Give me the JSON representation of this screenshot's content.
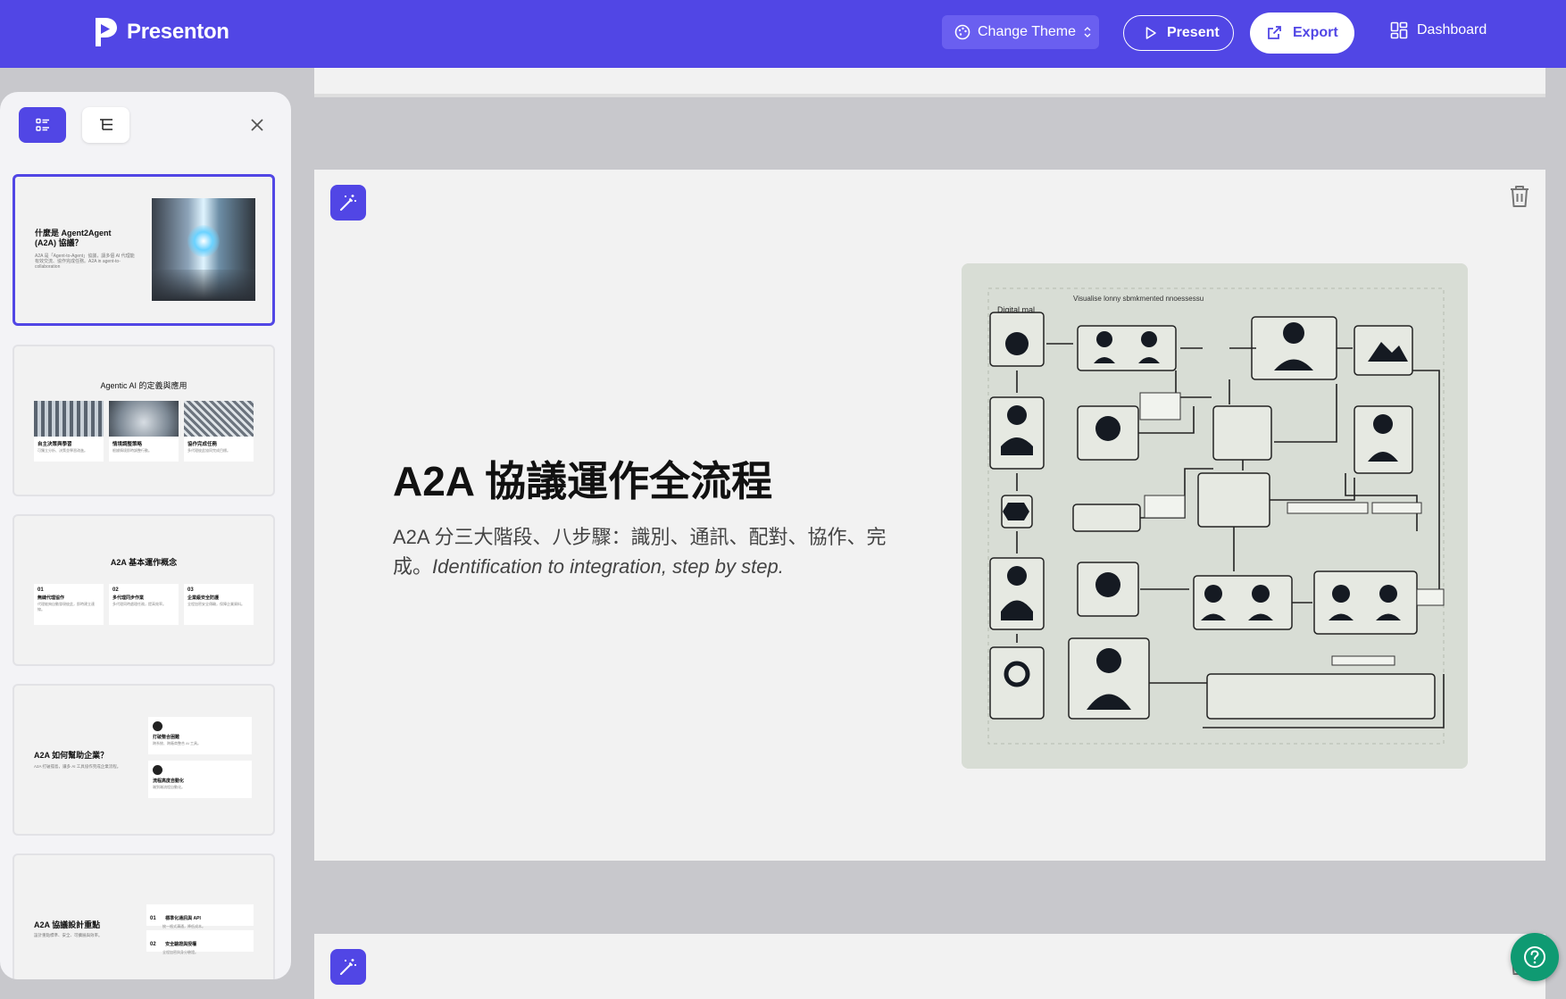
{
  "app": {
    "brand": "Presenton",
    "change_theme_label": "Change Theme",
    "present_label": "Present",
    "export_label": "Export",
    "dashboard_label": "Dashboard",
    "accent": "#5146e5"
  },
  "sidebar": {
    "thumbnails": [
      {
        "title": "什麼是 Agent2Agent (A2A) 協議？",
        "body": "A2A 是「Agent-to-Agent」協議，讓多個 AI 代理能有效交流、協作完成任務。A2A in agent-to-collaboration"
      },
      {
        "title": "Agentic AI 的定義與應用",
        "cards": [
          {
            "label": "自主決策與學習",
            "text": "可獨立分析、決策並學習改進。"
          },
          {
            "label": "情境調整策略",
            "text": "根據情境即時調整行動。"
          },
          {
            "label": "協作完成任務",
            "text": "多代理彼此協同完成目標。"
          }
        ]
      },
      {
        "title": "A2A 基本運作概念",
        "cards": [
          {
            "num": "01",
            "label": "無縫代理協作",
            "text": "代理能夠自動發現彼此，即時建立連線。"
          },
          {
            "num": "02",
            "label": "多代理同步作業",
            "text": "多代理同時處理任務，提高效率。"
          },
          {
            "num": "03",
            "label": "企業級安全防護",
            "text": "全程加密安全傳輸，保障企業資料。"
          }
        ]
      },
      {
        "title": "A2A 如何幫助企業？",
        "body": "A2A 打破孤島，讓多 AI 工具協作完成企業流程。",
        "cards": [
          {
            "label": "打破整合困難",
            "text": "跨系統、跨廠商整合 AI 工具。"
          },
          {
            "label": "流程高度自動化",
            "text": "端到端流程自動化。"
          }
        ]
      },
      {
        "title": "A2A 協議設計重點",
        "body": "設計重點標準、安全、可擴展與效率。",
        "cards": [
          {
            "num": "01",
            "label": "標準化通訊與 API",
            "text": "統一格式溝通，降低成本。"
          },
          {
            "num": "02",
            "label": "安全驗證與授權",
            "text": "全程加密與身分驗證。"
          }
        ]
      }
    ]
  },
  "slide": {
    "title": "A2A 協議運作全流程",
    "body_zh": "A2A 分三大階段、八步驟：識別、通訊、配對、協作、完成。",
    "body_en": "Identification to integration, step by step.",
    "image_caption": "Visualise lonny sbmkmented nnoessessu",
    "image_label": "Digital mal"
  }
}
